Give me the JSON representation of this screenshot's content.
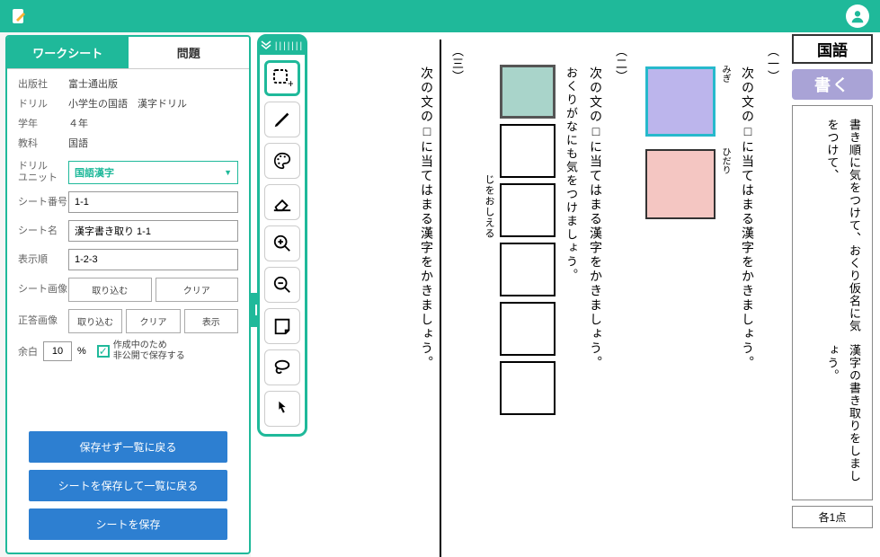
{
  "header": {},
  "tabs": {
    "worksheet": "ワークシート",
    "questions": "問題"
  },
  "meta": {
    "publisher_label": "出版社",
    "publisher": "富士通出版",
    "drill_label": "ドリル",
    "drill": "小学生の国語　漢字ドリル",
    "grade_label": "学年",
    "grade": "４年",
    "subject_label": "教科",
    "subject": "国語"
  },
  "form": {
    "drill_unit_label": "ドリル\nユニット",
    "drill_unit_value": "国語漢字",
    "sheet_no_label": "シート番号",
    "sheet_no": "1-1",
    "sheet_name_label": "シート名",
    "sheet_name": "漢字書き取り 1-1",
    "disp_order_label": "表示順",
    "disp_order": "1-2-3",
    "sheet_image_label": "シート画像",
    "answer_image_label": "正答画像",
    "import_btn": "取り込む",
    "clear_btn": "クリア",
    "show_btn": "表示"
  },
  "margin": {
    "label": "余白",
    "value": "10",
    "unit": "%",
    "checkbox_text": "作成中のため\n非公開で保存する"
  },
  "actions": {
    "back_no_save": "保存せず一覧に戻る",
    "save_back": "シートを保存して一覧に戻る",
    "save": "シートを保存"
  },
  "right": {
    "subject_title": "国語",
    "write_btn": "書く",
    "instruction_line1": "書き順に気をつけて、おくり仮名に気をつけて、",
    "instruction_line2": "漢字の書き取りをしましょう。",
    "score": "各1点"
  },
  "problems": {
    "p1": {
      "num": "（一）",
      "text": "次の文の□に当てはまる漢字をかきましょう。",
      "label_r": "みぎ",
      "label_l": "ひだり"
    },
    "p2": {
      "num": "（二）",
      "text": "次の文の□に当てはまる漢字をかきましょう。",
      "text2": "おくりがなにも気をつけましょう。",
      "hint": "じをおしえる"
    },
    "p3": {
      "num": "（三）",
      "text": "次の文の□に当てはまる漢字をかきましょう。"
    }
  }
}
